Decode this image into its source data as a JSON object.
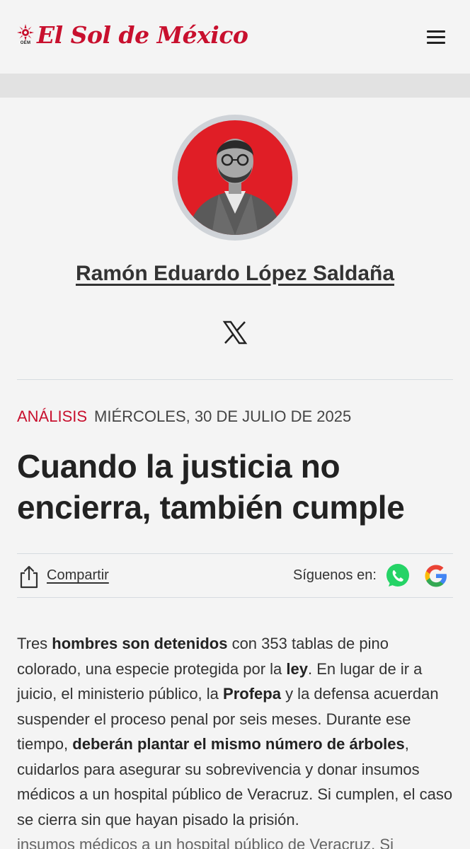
{
  "header": {
    "logo_text": "El Sol de México",
    "logo_badge": "OEM",
    "menu_icon": "hamburger-menu-icon"
  },
  "author": {
    "name": "Ramón Eduardo López Saldaña",
    "social_icon": "x-twitter-icon",
    "avatar_bg": "#e01e26"
  },
  "article": {
    "section": "ANÁLISIS",
    "date": "MIÉRCOLES, 30 DE JULIO DE 2025",
    "headline": "Cuando la justicia no encierra, también cumple",
    "share_label": "Compartir",
    "follow_label": "Síguenos en:",
    "follow_icons": [
      "whatsapp-icon",
      "google-icon"
    ],
    "body": [
      {
        "t": "Tres ",
        "b": false
      },
      {
        "t": "hombres son detenidos",
        "b": true
      },
      {
        "t": " con 353 tablas de pino colorado, una especie protegida por la ",
        "b": false
      },
      {
        "t": "ley",
        "b": true
      },
      {
        "t": ". En lugar de ir a juicio, el ministerio público, la ",
        "b": false
      },
      {
        "t": "Profepa",
        "b": true
      },
      {
        "t": " y la defensa acuerdan suspender el proceso penal por seis meses. Durante ese tiempo, ",
        "b": false
      },
      {
        "t": "deberán plantar el mismo número de árboles",
        "b": true
      },
      {
        "t": ", cuidarlos para asegurar su sobrevivencia y donar insumos médicos a un hospital público de Veracruz. Si cumplen, el caso se cierra sin que hayan pisado la prisión.",
        "b": false
      }
    ],
    "body_overflow": "insumos médicos a un hospital público de Veracruz. Si"
  },
  "colors": {
    "brand_red": "#c8102e",
    "background": "#f4f4f4",
    "whatsapp": "#25d366"
  }
}
